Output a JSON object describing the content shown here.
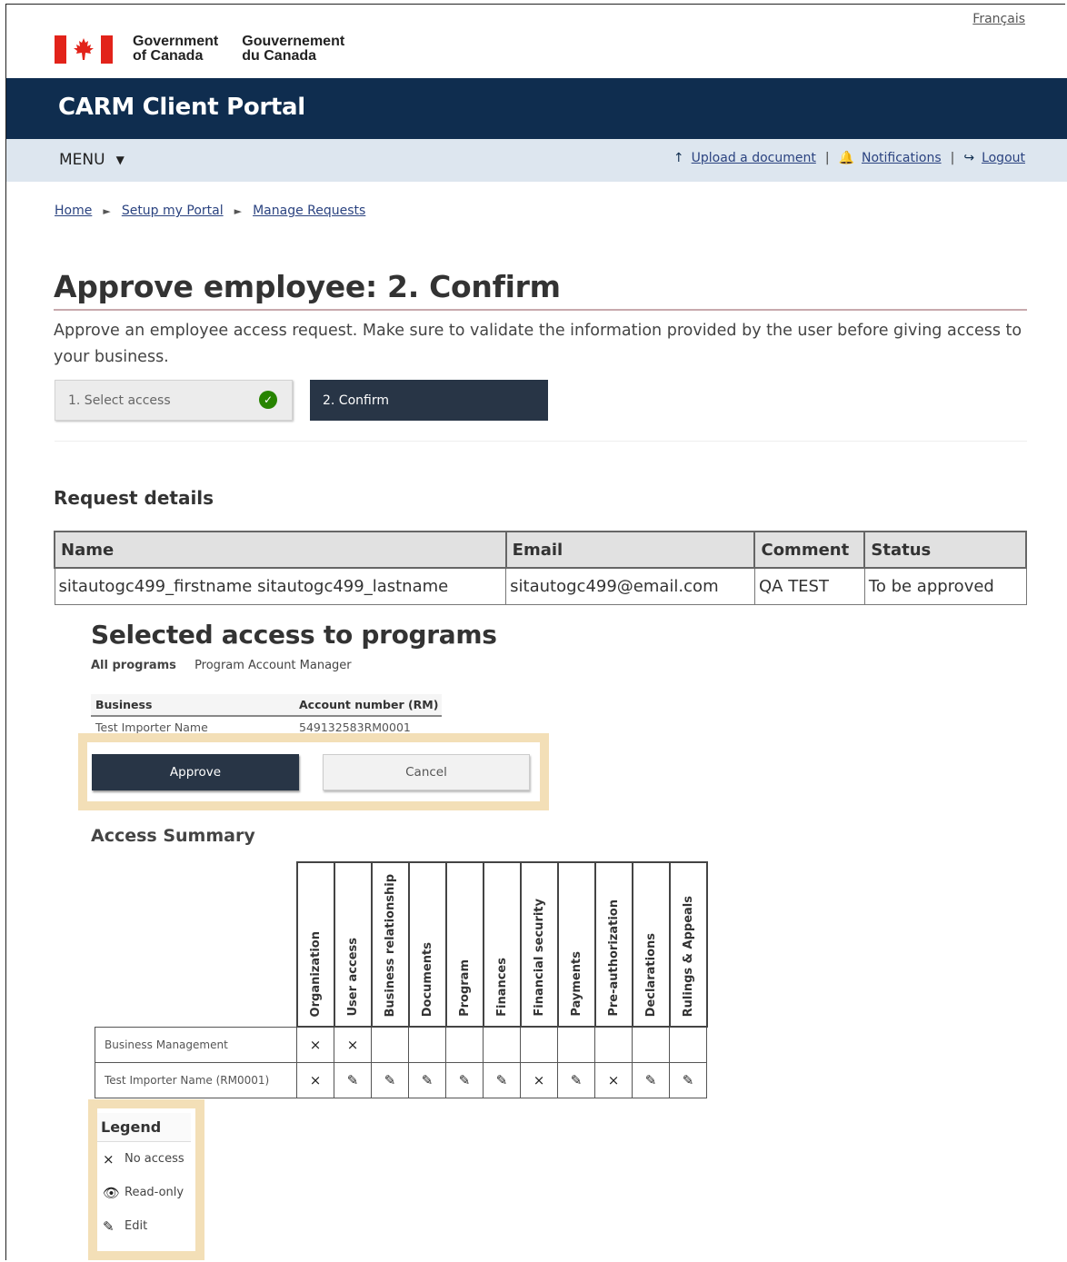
{
  "header": {
    "language_link": "Français",
    "gov_en_line1": "Government",
    "gov_en_line2": "of Canada",
    "gov_fr_line1": "Gouvernement",
    "gov_fr_line2": "du Canada",
    "portal_title": "CARM Client Portal"
  },
  "menubar": {
    "menu_label": "MENU",
    "upload_label": "Upload a document",
    "notifications_label": "Notifications",
    "logout_label": "Logout",
    "separator": "|"
  },
  "breadcrumb": {
    "items": [
      "Home",
      "Setup my Portal",
      "Manage Requests"
    ]
  },
  "page": {
    "title": "Approve employee: 2. Confirm",
    "intro": "Approve an employee access request. Make sure to validate the information provided by the user before giving access to your business."
  },
  "steps": {
    "step1_label": "1. Select access",
    "step2_label": "2. Confirm"
  },
  "request_details": {
    "heading": "Request details",
    "columns": [
      "Name",
      "Email",
      "Comment",
      "Status"
    ],
    "row": [
      "sitautogc499_firstname sitautogc499_lastname",
      "sitautogc499@email.com",
      "QA TEST",
      "To be approved"
    ]
  },
  "selected_access": {
    "heading": "Selected access to programs",
    "all_programs_label": "All programs",
    "role": "Program Account Manager",
    "columns": [
      "Business",
      "Account number (RM)"
    ],
    "row": [
      "Test Importer Name",
      "549132583RM0001"
    ]
  },
  "actions": {
    "approve_label": "Approve",
    "cancel_label": "Cancel"
  },
  "access_summary": {
    "heading": "Access Summary",
    "columns": [
      "Organization",
      "User access",
      "Business relationship",
      "Documents",
      "Program",
      "Finances",
      "Financial security",
      "Payments",
      "Pre-authorization",
      "Declarations",
      "Rulings & Appeals"
    ],
    "rows": [
      {
        "label": "Business Management",
        "cells": [
          "×",
          "×",
          "",
          "",
          "",
          "",
          "",
          "",
          "",
          "",
          ""
        ]
      },
      {
        "label": "Test Importer Name (RM0001)",
        "cells": [
          "×",
          "✎",
          "✎",
          "✎",
          "✎",
          "✎",
          "×",
          "✎",
          "×",
          "✎",
          "✎"
        ]
      }
    ]
  },
  "legend": {
    "heading": "Legend",
    "no_access": "No access",
    "read_only": "Read-only",
    "edit": "Edit",
    "no_access_glyph": "×",
    "read_only_glyph": "👁",
    "edit_glyph": "✎"
  },
  "colors": {
    "banner": "#0f2d4f",
    "menubar": "#dde6ef",
    "primary_button": "#283546",
    "highlight": "#f3dfb7",
    "success_check": "#278400",
    "flag_red": "#e2231a"
  }
}
